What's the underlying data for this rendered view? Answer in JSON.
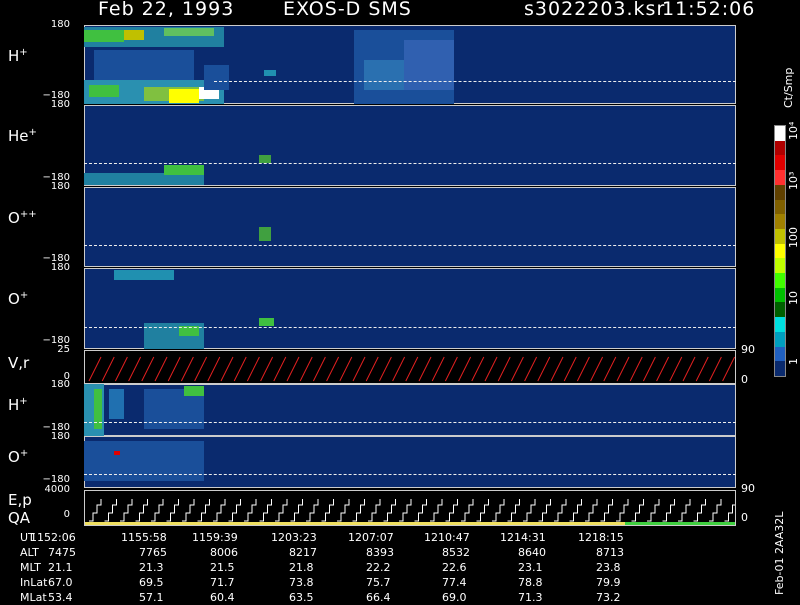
{
  "header": {
    "date": "Feb 22, 1993",
    "mission": "EXOS-D SMS",
    "file": "s3022203.ksr",
    "time": "11:52:06"
  },
  "panels": [
    {
      "label": "H",
      "sup": "+",
      "top_tick": "180",
      "bot_tick": "−180"
    },
    {
      "label": "He",
      "sup": "+",
      "top_tick": "180",
      "bot_tick": "−180"
    },
    {
      "label": "O",
      "sup": "++",
      "top_tick": "180",
      "bot_tick": "−180"
    },
    {
      "label": "O",
      "sup": "+",
      "top_tick": "180",
      "bot_tick": "−180"
    }
  ],
  "vr": {
    "label": "V,r",
    "top": "25",
    "bot": "0",
    "r_top": "90",
    "r_bot": "0"
  },
  "panels2": [
    {
      "label": "H",
      "sup": "+",
      "top_tick": "180",
      "bot_tick": "−180"
    },
    {
      "label": "O",
      "sup": "+",
      "top_tick": "180",
      "bot_tick": "−180"
    }
  ],
  "ep": {
    "label1": "E,p",
    "label2": "QA",
    "top": "4000",
    "bot": "0",
    "r_top": "90",
    "r_bot": "0"
  },
  "colorbar": {
    "unit": "Ct/Smp",
    "ticks": [
      "10⁴",
      "10³",
      "100",
      "10",
      "1"
    ],
    "colors": [
      "#ffffff",
      "#b00000",
      "#e00000",
      "#ff3030",
      "#604000",
      "#806000",
      "#a08000",
      "#c0c000",
      "#ffff00",
      "#c0ff00",
      "#40ff00",
      "#00c000",
      "#006000",
      "#00e0e0",
      "#00a0c0",
      "#2060c0",
      "#0a2a6e"
    ]
  },
  "side_info": "Feb-01 2AA32L",
  "ephemeris": {
    "rows": [
      {
        "name": "UT",
        "values": [
          "1152:06",
          "1155:58",
          "1159:39",
          "1203:23",
          "1207:07",
          "1210:47",
          "1214:31",
          "1218:15"
        ]
      },
      {
        "name": "ALT",
        "values": [
          "7475",
          "7765",
          "8006",
          "8217",
          "8393",
          "8532",
          "8640",
          "8713"
        ]
      },
      {
        "name": "MLT",
        "values": [
          "21.1",
          "21.3",
          "21.5",
          "21.8",
          "22.2",
          "22.6",
          "23.1",
          "23.8"
        ]
      },
      {
        "name": "InLat",
        "values": [
          "67.0",
          "69.5",
          "71.7",
          "73.8",
          "75.7",
          "77.4",
          "78.8",
          "79.9"
        ]
      },
      {
        "name": "MLat",
        "values": [
          "53.4",
          "57.1",
          "60.4",
          "63.5",
          "66.4",
          "69.0",
          "71.3",
          "73.2"
        ]
      }
    ]
  }
}
